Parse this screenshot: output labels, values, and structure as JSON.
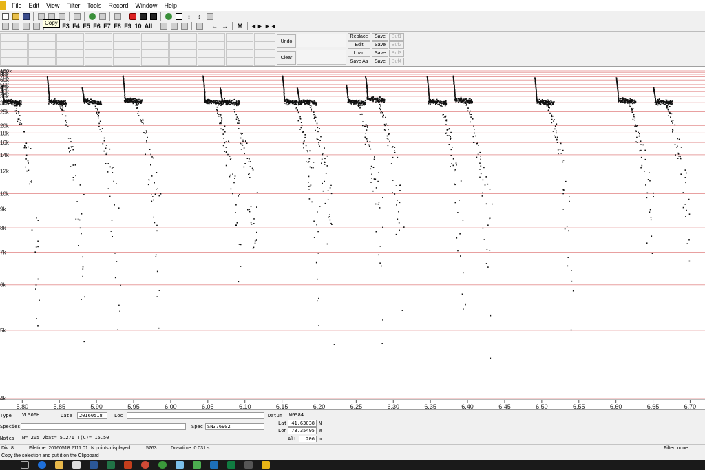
{
  "menu": [
    "File",
    "Edit",
    "View",
    "Filter",
    "Tools",
    "Record",
    "Window",
    "Help"
  ],
  "toolbar2": {
    "function_keys": [
      "F3",
      "F4",
      "F5",
      "F6",
      "F7",
      "F8",
      "F9",
      "10",
      "All"
    ],
    "markers": [
      "M"
    ]
  },
  "tooltip": "Copy",
  "label_panel": {
    "undo": "Undo",
    "clear": "Clear",
    "actions": [
      "Replace",
      "Edit",
      "Load",
      "Save As"
    ],
    "save": [
      "Save",
      "Save",
      "Save",
      "Save"
    ],
    "buffers": [
      "Buf1",
      "Buf2",
      "Buf3",
      "Buf4"
    ]
  },
  "chart_data": {
    "type": "scatter",
    "x_ticks": [
      "5.80",
      "5.85",
      "5.90",
      "5.95",
      "6.00",
      "6.05",
      "6.10",
      "6.15",
      "6.20",
      "6.25",
      "6.30",
      "6.35",
      "6.40",
      "6.45",
      "6.50",
      "6.55",
      "6.60",
      "6.65",
      "6.70"
    ],
    "x_range": [
      5.77,
      6.72
    ],
    "y_ticks": [
      "100k",
      "90k",
      "80k",
      "70k",
      "60k",
      "50k",
      "45k",
      "40k",
      "35k",
      "30k",
      "25k",
      "20k",
      "18k",
      "16k",
      "14k",
      "12k",
      "10k",
      "9k",
      "8k",
      "7k",
      "6k",
      "5k",
      "4k"
    ],
    "y_scale": "reciprocal",
    "gridlines": "horizontal",
    "grid_color": "#e8a0a0",
    "point_color": "#111111",
    "pulses": [
      {
        "x": 5.772,
        "f_start": 48000,
        "f_end": 30000
      },
      {
        "x": 5.833,
        "f_start": 73000,
        "f_end": 30000
      },
      {
        "x": 5.88,
        "f_start": 46000,
        "f_end": 30000
      },
      {
        "x": 5.935,
        "f_start": 75000,
        "f_end": 31000
      },
      {
        "x": 6.043,
        "f_start": 75000,
        "f_end": 30000
      },
      {
        "x": 6.066,
        "f_start": 45000,
        "f_end": 30000
      },
      {
        "x": 6.15,
        "f_start": 75000,
        "f_end": 30000
      },
      {
        "x": 6.17,
        "f_start": 45000,
        "f_end": 30000
      },
      {
        "x": 6.236,
        "f_start": 50000,
        "f_end": 30000
      },
      {
        "x": 6.262,
        "f_start": 72000,
        "f_end": 32000
      },
      {
        "x": 6.345,
        "f_start": 73000,
        "f_end": 30000
      },
      {
        "x": 6.38,
        "f_start": 75000,
        "f_end": 31000
      },
      {
        "x": 6.49,
        "f_start": 68000,
        "f_end": 30000
      },
      {
        "x": 6.6,
        "f_start": 68000,
        "f_end": 31000
      },
      {
        "x": 6.65,
        "f_start": 46000,
        "f_end": 30000
      }
    ]
  },
  "info": {
    "type_label": "Type",
    "type_value": "VLS06H",
    "date_label": "Date",
    "date_value": "20160518",
    "loc_label": "Loc",
    "species_label": "Species",
    "spec_label": "Spec",
    "spec_value": "SN376902",
    "notes_label": "Notes",
    "notes_value": "N= 205  Vbat=  5.271  T(C)=  15.50",
    "datum_label": "Datum",
    "datum_value": "WGS84",
    "lat_label": "Lat",
    "lat_value": "41.63038",
    "lat_dir": "N",
    "lon_label": "Lon",
    "lon_value": "73.35495",
    "lon_dir": "W",
    "alt_label": "Alt",
    "alt_value": "206",
    "alt_unit": "m"
  },
  "status": {
    "left": "Div: 8",
    "filetime": "Filetime: 20160518 2111 01",
    "npoints_label": "N points displayed:",
    "npoints_value": "5763",
    "drawtime": "Drawtime: 0.031 s",
    "filter": "Filter: none",
    "hint": "Copy the selection and put it on the Clipboard"
  }
}
